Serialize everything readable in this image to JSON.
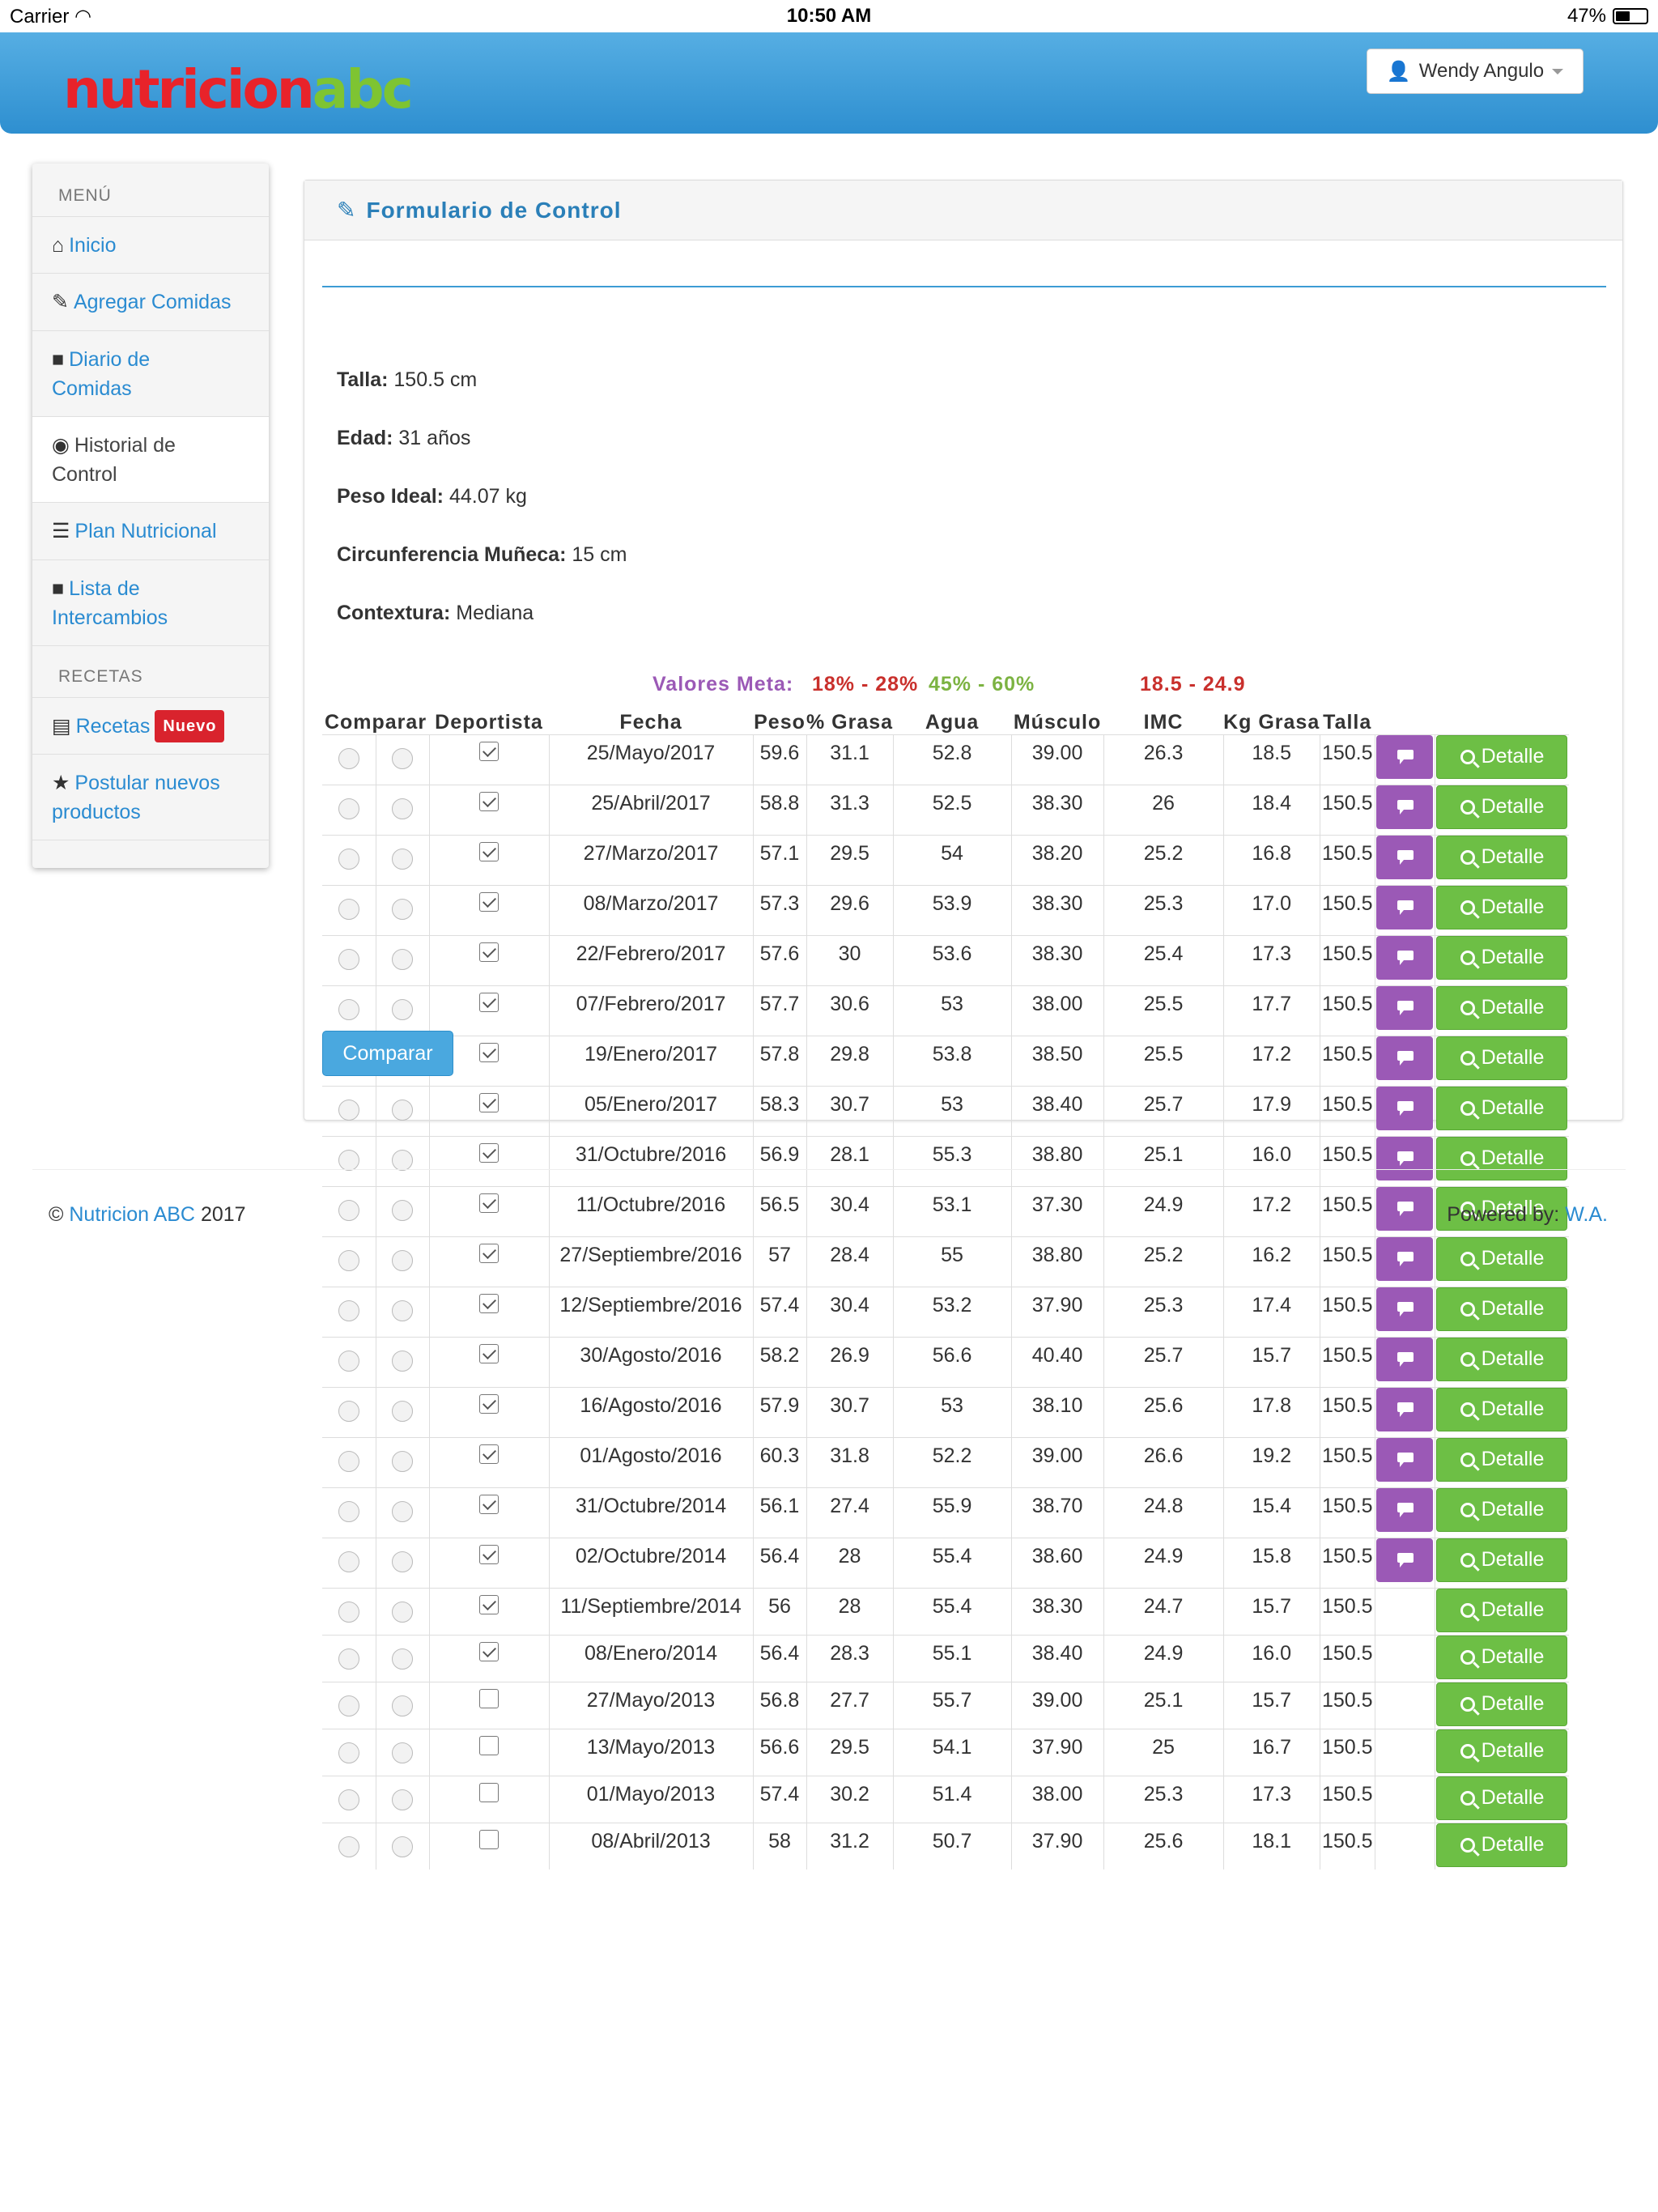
{
  "status_bar": {
    "carrier": "Carrier",
    "time": "10:50 AM",
    "battery": "47%",
    "battery_level": 0.47
  },
  "header": {
    "logo_part1": "nutricion",
    "logo_part2": "abc",
    "user_name": "Wendy Angulo"
  },
  "sidebar": {
    "menu_title": "MENÚ",
    "items": [
      {
        "label": "Inicio",
        "icon": "home-icon"
      },
      {
        "label": "Agregar Comidas",
        "icon": "edit-icon"
      },
      {
        "label": "Diario de Comidas",
        "icon": "folder-icon"
      },
      {
        "label": "Historial de Control",
        "icon": "eye-icon"
      },
      {
        "label": "Plan Nutricional",
        "icon": "list-icon"
      },
      {
        "label": "Lista de Intercambios",
        "icon": "folder-icon"
      }
    ],
    "recipes_title": "RECETAS",
    "recipes_label": "Recetas",
    "recipes_badge": "Nuevo",
    "postular_label": "Postular nuevos productos"
  },
  "panel": {
    "title": "Formulario de Control",
    "info": [
      {
        "label": "Talla:",
        "value": "150.5 cm"
      },
      {
        "label": "Edad:",
        "value": "31 años"
      },
      {
        "label": "Peso Ideal:",
        "value": "44.07 kg"
      },
      {
        "label": "Circunferencia Muñeca:",
        "value": "15 cm"
      },
      {
        "label": "Contextura:",
        "value": "Mediana"
      }
    ],
    "meta": {
      "label": "Valores Meta:",
      "grasa": "18% - 28%",
      "agua": "45% - 60%",
      "imc": "18.5 - 24.9"
    },
    "columns": [
      "Comparar",
      "Deportista",
      "Fecha",
      "Peso",
      "% Grasa",
      "Agua",
      "Músculo",
      "IMC",
      "Kg Grasa",
      "Talla"
    ],
    "detail_label": "Detalle",
    "compare_button": "Comparar",
    "rows": [
      {
        "fecha": "25/Mayo/2017",
        "peso": "59.6",
        "grasa": "31.1",
        "agua": "52.8",
        "musculo": "39.00",
        "imc": "26.3",
        "kggrasa": "18.5",
        "talla": "150.5",
        "deportista": true,
        "msg": true
      },
      {
        "fecha": "25/Abril/2017",
        "peso": "58.8",
        "grasa": "31.3",
        "agua": "52.5",
        "musculo": "38.30",
        "imc": "26",
        "kggrasa": "18.4",
        "talla": "150.5",
        "deportista": true,
        "msg": true
      },
      {
        "fecha": "27/Marzo/2017",
        "peso": "57.1",
        "grasa": "29.5",
        "agua": "54",
        "musculo": "38.20",
        "imc": "25.2",
        "kggrasa": "16.8",
        "talla": "150.5",
        "deportista": true,
        "msg": true
      },
      {
        "fecha": "08/Marzo/2017",
        "peso": "57.3",
        "grasa": "29.6",
        "agua": "53.9",
        "musculo": "38.30",
        "imc": "25.3",
        "kggrasa": "17.0",
        "talla": "150.5",
        "deportista": true,
        "msg": true
      },
      {
        "fecha": "22/Febrero/2017",
        "peso": "57.6",
        "grasa": "30",
        "agua": "53.6",
        "musculo": "38.30",
        "imc": "25.4",
        "kggrasa": "17.3",
        "talla": "150.5",
        "deportista": true,
        "msg": true
      },
      {
        "fecha": "07/Febrero/2017",
        "peso": "57.7",
        "grasa": "30.6",
        "agua": "53",
        "musculo": "38.00",
        "imc": "25.5",
        "kggrasa": "17.7",
        "talla": "150.5",
        "deportista": true,
        "msg": true
      },
      {
        "fecha": "19/Enero/2017",
        "peso": "57.8",
        "grasa": "29.8",
        "agua": "53.8",
        "musculo": "38.50",
        "imc": "25.5",
        "kggrasa": "17.2",
        "talla": "150.5",
        "deportista": true,
        "msg": true
      },
      {
        "fecha": "05/Enero/2017",
        "peso": "58.3",
        "grasa": "30.7",
        "agua": "53",
        "musculo": "38.40",
        "imc": "25.7",
        "kggrasa": "17.9",
        "talla": "150.5",
        "deportista": true,
        "msg": true
      },
      {
        "fecha": "31/Octubre/2016",
        "peso": "56.9",
        "grasa": "28.1",
        "agua": "55.3",
        "musculo": "38.80",
        "imc": "25.1",
        "kggrasa": "16.0",
        "talla": "150.5",
        "deportista": true,
        "msg": true
      },
      {
        "fecha": "11/Octubre/2016",
        "peso": "56.5",
        "grasa": "30.4",
        "agua": "53.1",
        "musculo": "37.30",
        "imc": "24.9",
        "kggrasa": "17.2",
        "talla": "150.5",
        "deportista": true,
        "msg": true
      },
      {
        "fecha": "27/Septiembre/2016",
        "peso": "57",
        "grasa": "28.4",
        "agua": "55",
        "musculo": "38.80",
        "imc": "25.2",
        "kggrasa": "16.2",
        "talla": "150.5",
        "deportista": true,
        "msg": true
      },
      {
        "fecha": "12/Septiembre/2016",
        "peso": "57.4",
        "grasa": "30.4",
        "agua": "53.2",
        "musculo": "37.90",
        "imc": "25.3",
        "kggrasa": "17.4",
        "talla": "150.5",
        "deportista": true,
        "msg": true
      },
      {
        "fecha": "30/Agosto/2016",
        "peso": "58.2",
        "grasa": "26.9",
        "agua": "56.6",
        "musculo": "40.40",
        "imc": "25.7",
        "kggrasa": "15.7",
        "talla": "150.5",
        "deportista": true,
        "msg": true
      },
      {
        "fecha": "16/Agosto/2016",
        "peso": "57.9",
        "grasa": "30.7",
        "agua": "53",
        "musculo": "38.10",
        "imc": "25.6",
        "kggrasa": "17.8",
        "talla": "150.5",
        "deportista": true,
        "msg": true
      },
      {
        "fecha": "01/Agosto/2016",
        "peso": "60.3",
        "grasa": "31.8",
        "agua": "52.2",
        "musculo": "39.00",
        "imc": "26.6",
        "kggrasa": "19.2",
        "talla": "150.5",
        "deportista": true,
        "msg": true
      },
      {
        "fecha": "31/Octubre/2014",
        "peso": "56.1",
        "grasa": "27.4",
        "agua": "55.9",
        "musculo": "38.70",
        "imc": "24.8",
        "kggrasa": "15.4",
        "talla": "150.5",
        "deportista": true,
        "msg": true
      },
      {
        "fecha": "02/Octubre/2014",
        "peso": "56.4",
        "grasa": "28",
        "agua": "55.4",
        "musculo": "38.60",
        "imc": "24.9",
        "kggrasa": "15.8",
        "talla": "150.5",
        "deportista": true,
        "msg": true
      },
      {
        "fecha": "11/Septiembre/2014",
        "peso": "56",
        "grasa": "28",
        "agua": "55.4",
        "musculo": "38.30",
        "imc": "24.7",
        "kggrasa": "15.7",
        "talla": "150.5",
        "deportista": true,
        "msg": false
      },
      {
        "fecha": "08/Enero/2014",
        "peso": "56.4",
        "grasa": "28.3",
        "agua": "55.1",
        "musculo": "38.40",
        "imc": "24.9",
        "kggrasa": "16.0",
        "talla": "150.5",
        "deportista": true,
        "msg": false
      },
      {
        "fecha": "27/Mayo/2013",
        "peso": "56.8",
        "grasa": "27.7",
        "agua": "55.7",
        "musculo": "39.00",
        "imc": "25.1",
        "kggrasa": "15.7",
        "talla": "150.5",
        "deportista": false,
        "msg": false
      },
      {
        "fecha": "13/Mayo/2013",
        "peso": "56.6",
        "grasa": "29.5",
        "agua": "54.1",
        "musculo": "37.90",
        "imc": "25",
        "kggrasa": "16.7",
        "talla": "150.5",
        "deportista": false,
        "msg": false
      },
      {
        "fecha": "01/Mayo/2013",
        "peso": "57.4",
        "grasa": "30.2",
        "agua": "51.4",
        "musculo": "38.00",
        "imc": "25.3",
        "kggrasa": "17.3",
        "talla": "150.5",
        "deportista": false,
        "msg": false
      },
      {
        "fecha": "08/Abril/2013",
        "peso": "58",
        "grasa": "31.2",
        "agua": "50.7",
        "musculo": "37.90",
        "imc": "25.6",
        "kggrasa": "18.1",
        "talla": "150.5",
        "deportista": false,
        "msg": false
      }
    ]
  },
  "footer": {
    "copyright": "©",
    "brand": "Nutricion ABC",
    "year": "2017",
    "powered_label": "Powered by:",
    "powered_link": "W.A."
  },
  "colors": {
    "header": "#3c9bd9",
    "link": "#2a8bd1",
    "detail_button": "#6dbf45",
    "message_button": "#9b59b6",
    "meta_label": "#9b59b6",
    "meta_red": "#c9302c",
    "meta_green": "#7cb342"
  }
}
